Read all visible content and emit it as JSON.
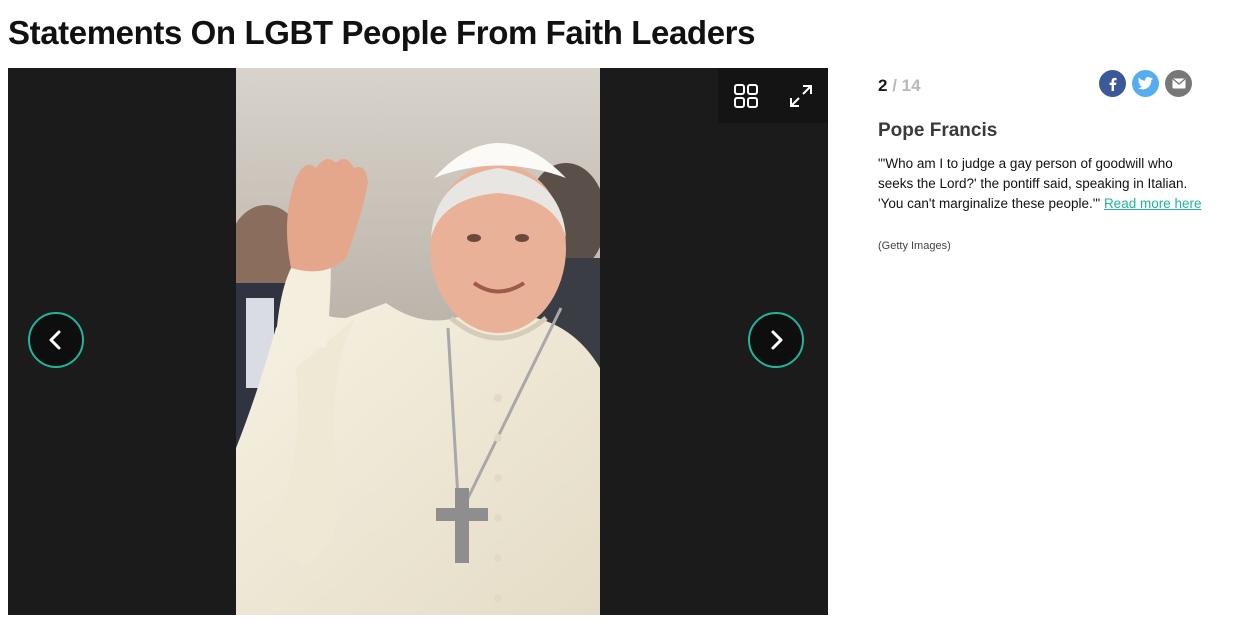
{
  "page_title": "Statements On LGBT People From Faith Leaders",
  "gallery": {
    "current": "2",
    "separator": "/",
    "total": "14",
    "prev_icon": "chevron-left-icon",
    "next_icon": "chevron-right-icon",
    "grid_icon": "grid-view-icon",
    "expand_icon": "expand-icon"
  },
  "share": {
    "facebook": "facebook-icon",
    "twitter": "twitter-icon",
    "email": "email-icon"
  },
  "slide": {
    "title": "Pope Francis",
    "caption": "\"'Who am I to judge a gay person of goodwill who seeks the Lord?' the pontiff said, speaking in Italian. 'You can't marginalize these people.'\"",
    "link_text": "Read more here",
    "credit": "(Getty Images)"
  },
  "colors": {
    "accent": "#21b49b",
    "stage_bg": "#1b1b1b",
    "facebook": "#3b5998",
    "twitter": "#55acee",
    "email": "#777777"
  }
}
